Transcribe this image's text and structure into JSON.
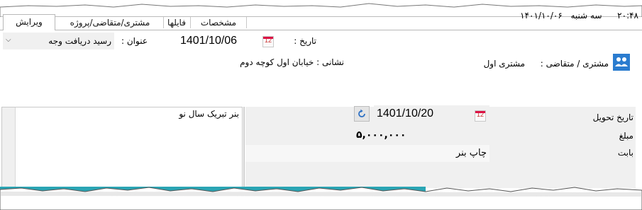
{
  "status_bar": {
    "time": "۲۰:۴۸",
    "day": "سه شنبه",
    "date": "۱۴۰۱/۱۰/۰۶"
  },
  "tabs": [
    {
      "label": "ویرایش",
      "active": true
    },
    {
      "label": "مشتری/متقاضی/پروژه",
      "active": false
    },
    {
      "label": "فایلها",
      "active": false
    },
    {
      "label": "مشخصات",
      "active": false
    }
  ],
  "form": {
    "date_label": "تاریخ :",
    "date_value": "1401/10/06",
    "title_label": "عنوان :",
    "title_value": "رسید دریافت وجه",
    "customer_label": "مشتری / متقاضی :",
    "customer_value": "مشتری اول",
    "address_label": "نشانی :",
    "address_value": "خیابان اول کوچه دوم"
  },
  "details": {
    "delivery_label": "تاریخ تحویل",
    "delivery_value": "1401/10/20",
    "amount_label": "مبلغ",
    "amount_value": "۵,۰۰۰,۰۰۰",
    "subject_label": "بابت",
    "subject_value": "چاپ بنر",
    "notes_value": "بنر تبریک سال نو"
  },
  "icons": {
    "calendar": "calendar-icon",
    "refresh": "refresh-icon",
    "customer": "customer-group-icon",
    "dropdown": "chevron-down-icon"
  },
  "colors": {
    "accent_teal": "#2aa5b4",
    "refresh_blue": "#2b6fc4",
    "calendar_red": "#d11a2a"
  }
}
